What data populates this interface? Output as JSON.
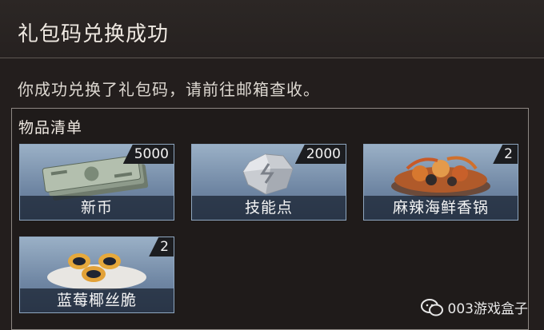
{
  "header": {
    "title": "礼包码兑换成功"
  },
  "message": "你成功兑换了礼包码，请前往邮箱查收。",
  "panel": {
    "title": "物品清单",
    "items": [
      {
        "name": "新币",
        "count": "5000",
        "icon": "banknotes-icon"
      },
      {
        "name": "技能点",
        "count": "2000",
        "icon": "skill-crystal-icon"
      },
      {
        "name": "麻辣海鲜香锅",
        "count": "2",
        "icon": "seafood-pot-icon"
      },
      {
        "name": "蓝莓椰丝脆",
        "count": "2",
        "icon": "blueberry-tart-icon"
      }
    ]
  },
  "watermark": {
    "text": "003游戏盒子",
    "icon": "wechat-icon"
  },
  "colors": {
    "background": "#231e1d",
    "item_bg": "#7d93ae",
    "count_bg": "#1c1d20"
  }
}
